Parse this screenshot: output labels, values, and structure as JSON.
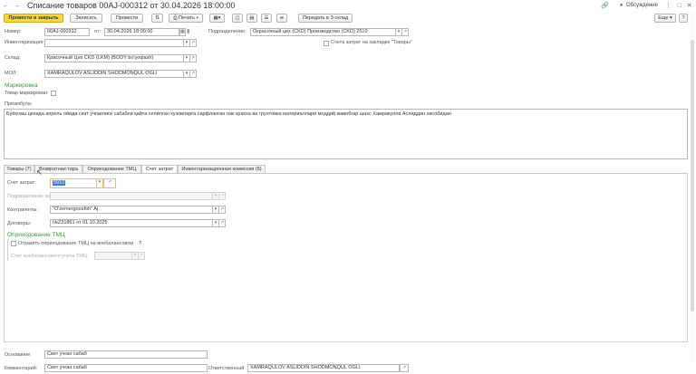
{
  "window": {
    "title": "Списание товаров 00AJ-000312 от 30.04.2026 18:00:00",
    "discussion": "Обсуждение"
  },
  "toolbar": {
    "post_close": "Провести и закрыть",
    "save": "Записать",
    "post": "Провести",
    "print": "Печать",
    "send": "Передать в З-склад",
    "more": "Еще",
    "help": "?"
  },
  "header": {
    "number_label": "Номер:",
    "number": "00AJ-000312",
    "date_label": "от:",
    "date": "30.04.2026 18:00:00",
    "division_label": "Подразделение:",
    "division": "Окрасочный цех (CKD) Производство (CKD) 2510",
    "inventory_label": "Инвентаризация:",
    "inventory": "",
    "accounts_checkbox_label": "Счета затрат на закладке \"Товары\"",
    "warehouse_label": "Склад:",
    "warehouse": "Красочный Цех CKD (LKM) (BODY bo'yoqlash)",
    "mol_label": "МОЛ:",
    "mol": "XAMRAQULOV ASLIDDIN SHODMONQUL OGLI",
    "marking_section": "Маркировка",
    "marked_goods_label": "Товар маркирован:",
    "preamble_label": "Преамбула:",
    "preamble": "Бўёқчаш цехида апрель ойида сизт ўчгаелиги сабабли қайта сепилган кузовларга сарфланган лак краска ва грунтовка материаллари моддий жавобгар шахс Хамракулов Аслиддин хисобидан"
  },
  "tabs": [
    {
      "label": "Товары (7)"
    },
    {
      "label": "Возвратная тара"
    },
    {
      "label": "Оприходование ТМЦ"
    },
    {
      "label": "Счет затрат"
    },
    {
      "label": "Инвентаризационная комиссия (5)"
    }
  ],
  "cost_tab": {
    "account_label": "Счет затрат:",
    "account": "5910",
    "cost_division_label": "Подразделение затрат:",
    "cost_division": "",
    "contractors_label": "Контрагенты:",
    "contractor": "\"O'zemergoosfoh\" Aj",
    "contracts_label": "Договоры:",
    "contract": "№Z31861 от 01.10.2025",
    "oprihod_section": "Оприходование ТМЦ",
    "offbalance_checkbox_label": "Отразить оприходование ТМЦ на внебалансовом",
    "offbalance_account_label": "Счет внебалансового учета ТМЦ:",
    "offbalance_account": ""
  },
  "footer": {
    "basis_label": "Основание:",
    "basis": "Свет ўчган сабаб",
    "comment_label": "Комментарий:",
    "comment": "Свет ўчган сабаб",
    "responsible_label": "Ответственный:",
    "responsible": "XAMRAQULOV ASLIDDIN SHODMONQUL OGLI"
  }
}
